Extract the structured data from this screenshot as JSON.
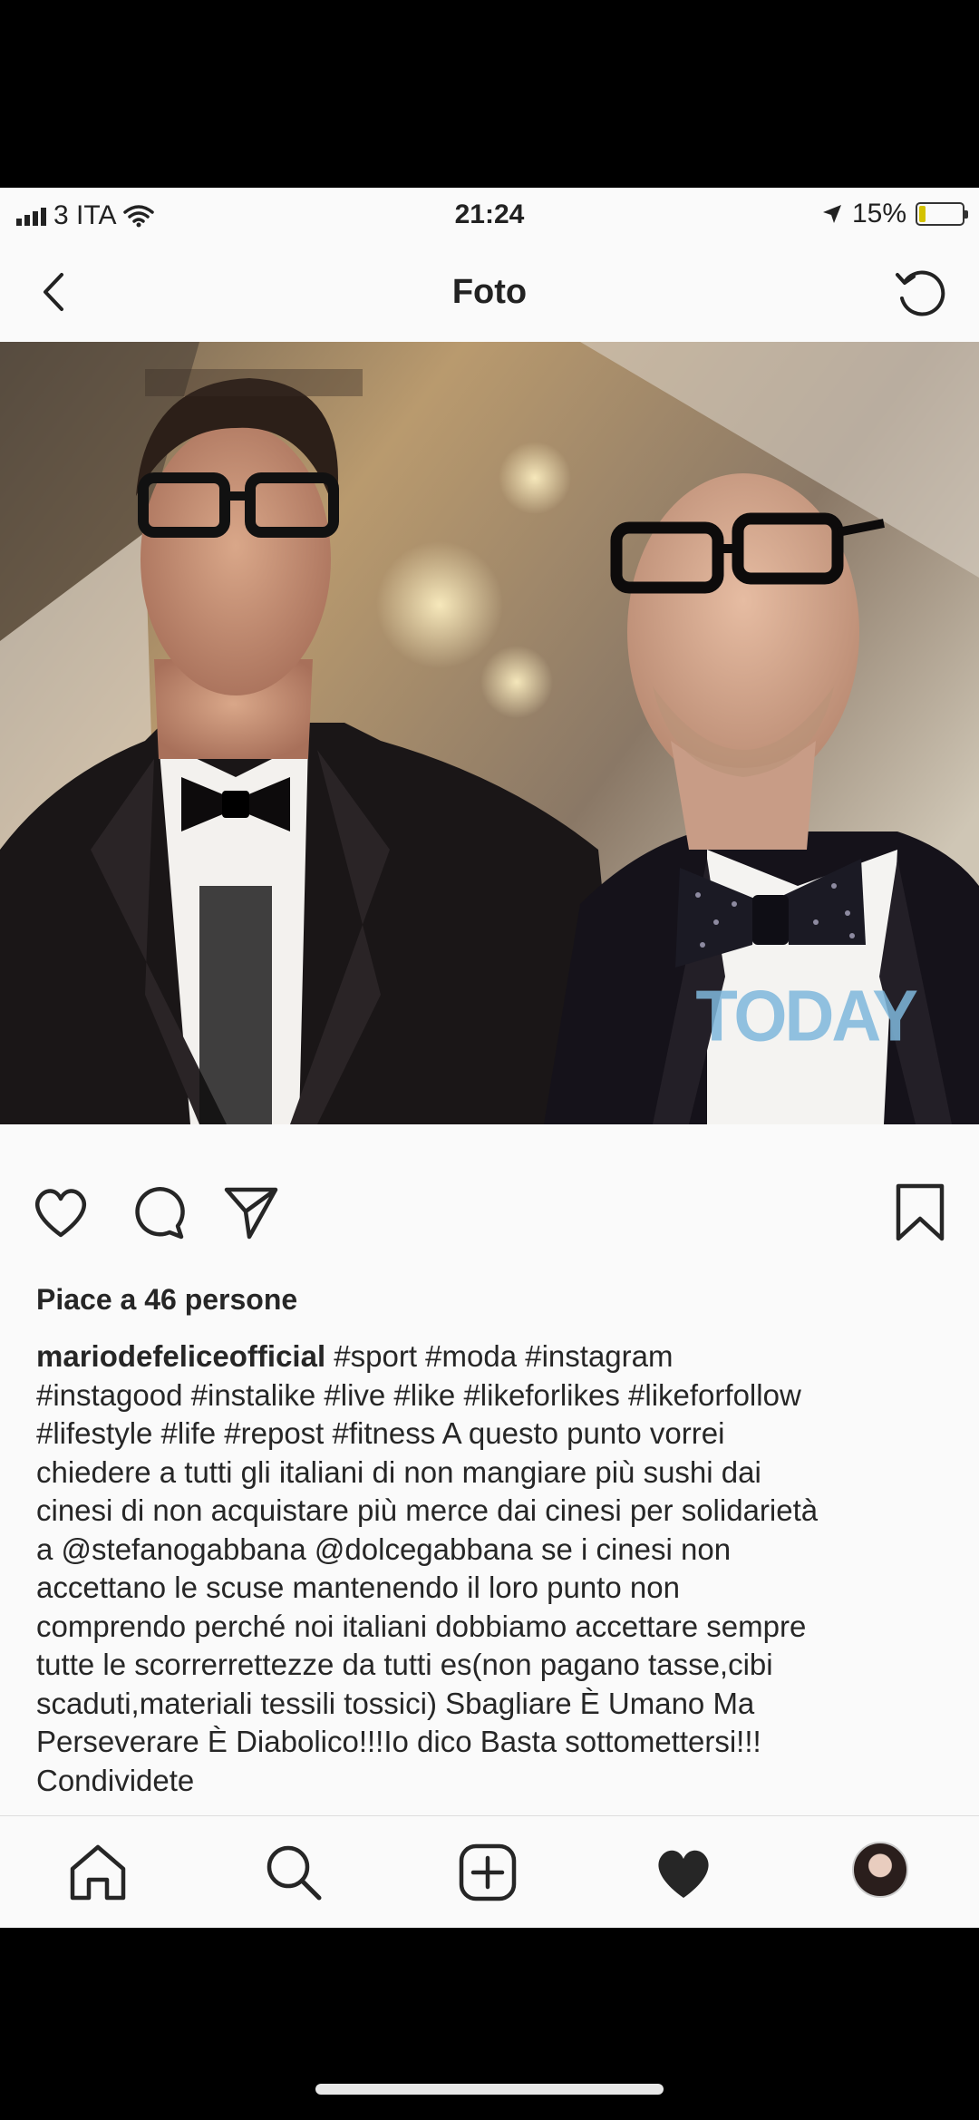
{
  "status_bar": {
    "carrier": "3 ITA",
    "time": "21:24",
    "battery_percent": "15%",
    "battery_level": 0.15,
    "icons": [
      "signal-icon",
      "wifi-icon",
      "location-arrow-icon",
      "battery-icon"
    ]
  },
  "nav": {
    "title": "Foto",
    "back_icon": "chevron-left-icon",
    "refresh_icon": "refresh-icon"
  },
  "photo": {
    "watermark": "TODAY"
  },
  "actions": {
    "icons": [
      "heart-icon",
      "comment-icon",
      "share-icon",
      "bookmark-icon"
    ]
  },
  "post": {
    "likes": "Piace a 46 persone",
    "username": "mariodefeliceofficial",
    "caption_lines": [
      " #sport #moda #instagram",
      "#instagood #instalike #live #like #likeforlikes #likeforfollow",
      "#lifestyle #life #repost #fitness A questo punto vorrei",
      "chiedere a tutti gli italiani di non mangiare più sushi dai",
      "cinesi di non acquistare più merce dai cinesi per solidarietà",
      "a @stefanogabbana @dolcegabbana se i cinesi non",
      "accettano le scuse mantenendo il loro punto non",
      "comprendo perché noi italiani dobbiamo accettare sempre",
      "tutte le scorrerrettezze da tutti es(non pagano tasse,cibi",
      "scaduti,materiali tessili tossici) Sbagliare È Umano Ma",
      "Perseverare È Diabolico!!!Io dico Basta sottomettersi!!!",
      "Condividete"
    ]
  },
  "tab_bar": {
    "icons": [
      "home-icon",
      "search-icon",
      "add-post-icon",
      "activity-heart-icon",
      "profile-avatar"
    ]
  },
  "colors": {
    "background": "#fafafa",
    "text": "#262626",
    "watermark": "#7fb8dc"
  }
}
